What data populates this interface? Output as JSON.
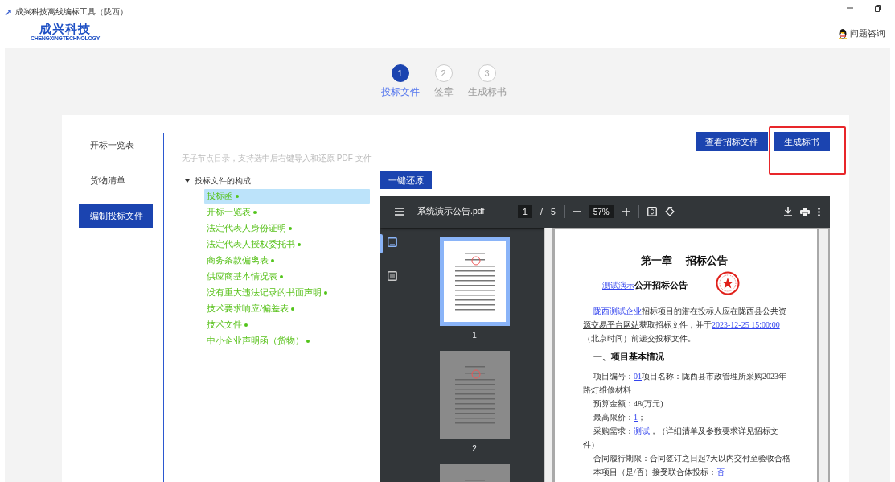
{
  "window": {
    "title": "成兴科技离线编标工具（陇西）"
  },
  "logo": {
    "name": "成兴科技",
    "tagline": "CHENGXINGTECHNOLOGY"
  },
  "help_link": {
    "label": "问题咨询"
  },
  "steps": [
    {
      "number": "1",
      "label": "投标文件",
      "selected": true
    },
    {
      "number": "2",
      "label": "签章",
      "selected": false
    },
    {
      "number": "3",
      "label": "生成标书",
      "selected": false
    }
  ],
  "sidebar": {
    "items": [
      {
        "label": "开标一览表",
        "selected": false
      },
      {
        "label": "货物清单",
        "selected": false
      },
      {
        "label": "编制投标文件",
        "selected": true
      }
    ]
  },
  "actions": [
    {
      "label": "查看招标文件",
      "highlighted": false
    },
    {
      "label": "生成标书",
      "highlighted": true
    }
  ],
  "hint": "无子节点目录，支持选中后右键导入和还原 PDF 文件",
  "tree": {
    "label": "投标文件的构成",
    "expanded": true,
    "children": [
      {
        "label": "投标函",
        "selected": true
      },
      {
        "label": "开标一览表",
        "selected": false
      },
      {
        "label": "法定代表人身份证明",
        "selected": false
      },
      {
        "label": "法定代表人授权委托书",
        "selected": false
      },
      {
        "label": "商务条款偏离表",
        "selected": false
      },
      {
        "label": "供应商基本情况表",
        "selected": false
      },
      {
        "label": "没有重大违法记录的书面声明",
        "selected": false
      },
      {
        "label": "技术要求响应/偏差表",
        "selected": false
      },
      {
        "label": "技术文件",
        "selected": false
      },
      {
        "label": "中小企业声明函（货物）",
        "selected": false
      }
    ]
  },
  "restore_button": "一键还原",
  "pdf_viewer": {
    "filename": "系统演示公告.pdf",
    "page": "1",
    "separator": "/",
    "page_total": "5",
    "zoom": "57%",
    "thumbnails": [
      {
        "page_label": "1",
        "selected": true
      },
      {
        "page_label": "2",
        "selected": false
      },
      {
        "selected": false
      }
    ],
    "document": {
      "heading": "第一章　 招标公告",
      "subtitle": [
        {
          "kind": "field",
          "text": "测试演示"
        },
        {
          "kind": "bold",
          "text": "公开招标公告"
        }
      ],
      "blocks": [
        {
          "kind": "para",
          "segments": [
            {
              "kind": "field",
              "text": "陇西测试企业"
            },
            {
              "kind": "text",
              "text": "招标项目的潜在投标人应在"
            },
            {
              "kind": "underline",
              "text": "陇西县公共资源交易平台网站"
            },
            {
              "kind": "text",
              "text": "获取招标文件，并于"
            },
            {
              "kind": "field",
              "text": "2023-12-25 15:00:00"
            },
            {
              "kind": "text",
              "text": "（北京时间）前递交投标文件。"
            }
          ]
        },
        {
          "kind": "heading",
          "segments": [
            {
              "kind": "text",
              "text": "一、项目基本情况"
            }
          ]
        },
        {
          "kind": "para",
          "segments": [
            {
              "kind": "text",
              "text": "项目编号："
            },
            {
              "kind": "field",
              "text": "01"
            },
            {
              "kind": "text",
              "text": "项目名称：陇西县市政管理所采购2023年路灯维修材料"
            }
          ]
        },
        {
          "kind": "para",
          "segments": [
            {
              "kind": "text",
              "text": "预算金额：48(万元)"
            }
          ]
        },
        {
          "kind": "para",
          "segments": [
            {
              "kind": "text",
              "text": "最高限价："
            },
            {
              "kind": "field",
              "text": "1"
            },
            {
              "kind": "text",
              "text": "；"
            }
          ]
        },
        {
          "kind": "para",
          "segments": [
            {
              "kind": "text",
              "text": "采购需求："
            },
            {
              "kind": "field",
              "text": "测试"
            },
            {
              "kind": "text",
              "text": "，（详细清单及参数要求详见招标文件）"
            }
          ]
        },
        {
          "kind": "para",
          "segments": [
            {
              "kind": "text",
              "text": "合同履行期限：合同签订之日起7天以内交付至验收合格"
            }
          ]
        },
        {
          "kind": "para",
          "segments": [
            {
              "kind": "text",
              "text": "本项目（是/否）接受联合体投标："
            },
            {
              "kind": "field",
              "text": "否"
            }
          ]
        }
      ]
    }
  }
}
